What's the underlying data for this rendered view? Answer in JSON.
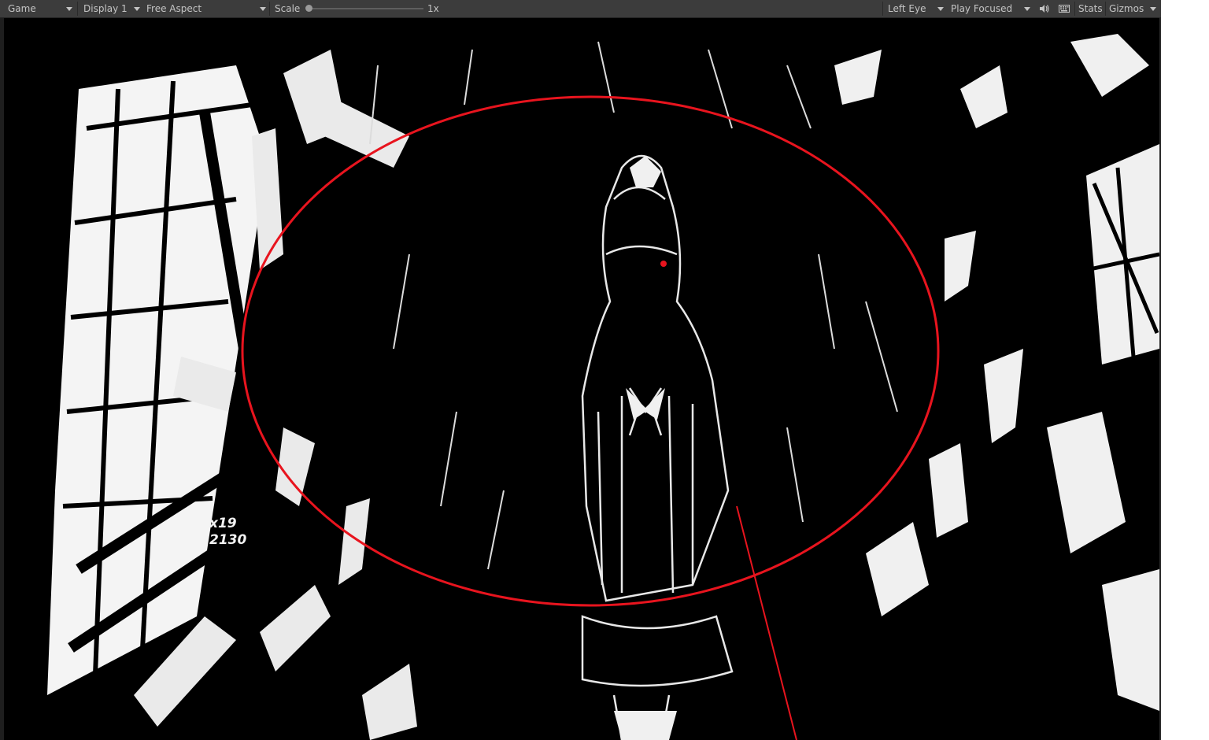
{
  "toolbar": {
    "game_tab": "Game",
    "display": "Display 1",
    "aspect": "Free Aspect",
    "scale_label": "Scale",
    "scale_value": "1x",
    "eye": "Left Eye",
    "play_mode": "Play Focused",
    "mute_icon": "speaker-icon",
    "keyboard_icon": "keyboard-icon",
    "stats_label": "Stats",
    "gizmos_label": "Gizmos"
  },
  "viewport": {
    "overlay_line1": "x19",
    "overlay_line2": "2130",
    "annotation_color": "#e8141e"
  }
}
